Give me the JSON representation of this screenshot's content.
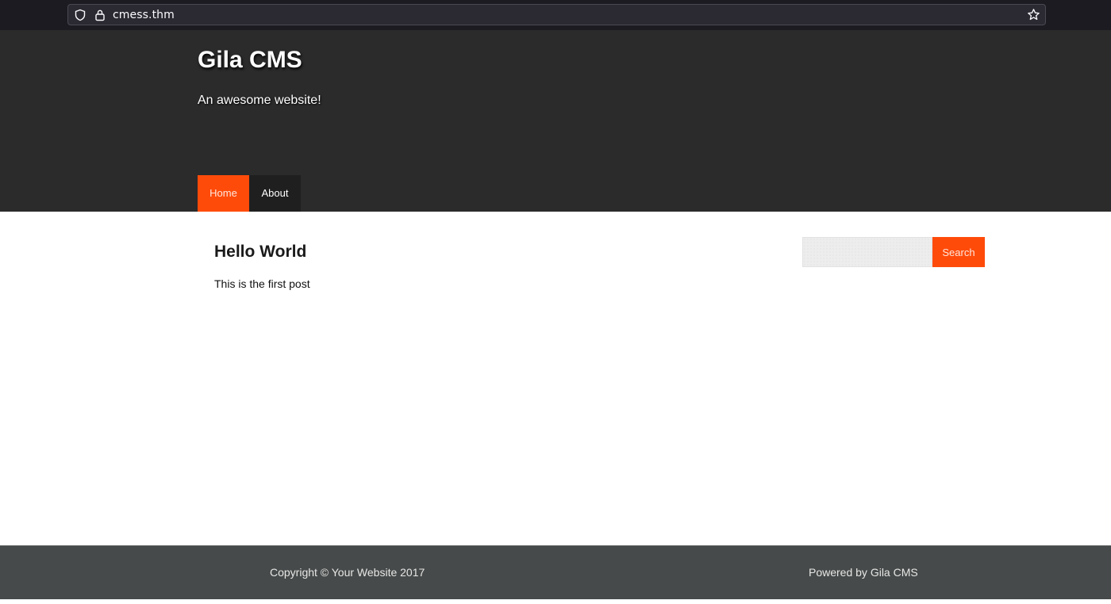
{
  "browser": {
    "url": "cmess.thm",
    "icons": [
      "shield-icon",
      "lock-icon",
      "star-icon"
    ]
  },
  "header": {
    "title": "Gila CMS",
    "tagline": "An awesome website!",
    "nav": [
      {
        "label": "Home",
        "active": true
      },
      {
        "label": "About",
        "active": false
      }
    ]
  },
  "post": {
    "title": "Hello World",
    "body": "This is the first post"
  },
  "search": {
    "value": "",
    "button_label": "Search"
  },
  "footer": {
    "copyright": "Copyright © Your Website 2017",
    "powered_by": "Powered by Gila CMS"
  },
  "colors": {
    "accent": "#ff4b0a",
    "header_bg": "#2b2b2b",
    "footer_bg": "#474a4a"
  }
}
